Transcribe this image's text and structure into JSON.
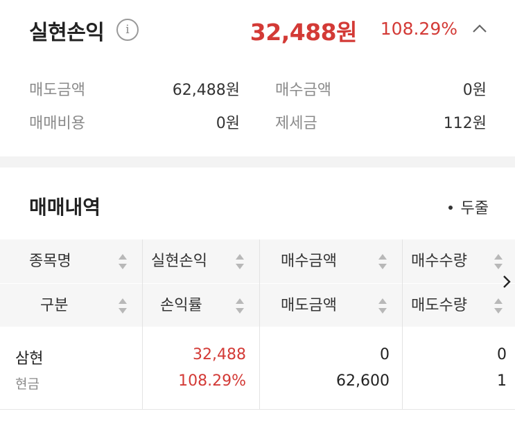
{
  "header": {
    "title": "실현손익",
    "info_icon": "info-icon",
    "pnl": "32,488원",
    "pnl_rate": "108.29%",
    "collapse_icon": "chevron-up-icon"
  },
  "summary": {
    "sell_amount_label": "매도금액",
    "sell_amount_value": "62,488원",
    "buy_amount_label": "매수금액",
    "buy_amount_value": "0원",
    "trade_cost_label": "매매비용",
    "trade_cost_value": "0원",
    "tax_label": "제세금",
    "tax_value": "112원"
  },
  "history": {
    "title": "매매내역",
    "layout_toggle": "두줄"
  },
  "table": {
    "header_row1": [
      "종목명",
      "실현손익",
      "매수금액",
      "매수수량"
    ],
    "header_row2": [
      "구분",
      "손익률",
      "매도금액",
      "매도수량"
    ],
    "rows": [
      {
        "name": "삼현",
        "type": "현금",
        "realized_pnl": "32,488",
        "pnl_rate": "108.29%",
        "buy_amount": "0",
        "sell_amount": "62,600",
        "buy_qty": "0",
        "sell_qty": "1"
      }
    ]
  },
  "colors": {
    "profit": "#d33a36",
    "header_bg": "#f6f6f6"
  }
}
